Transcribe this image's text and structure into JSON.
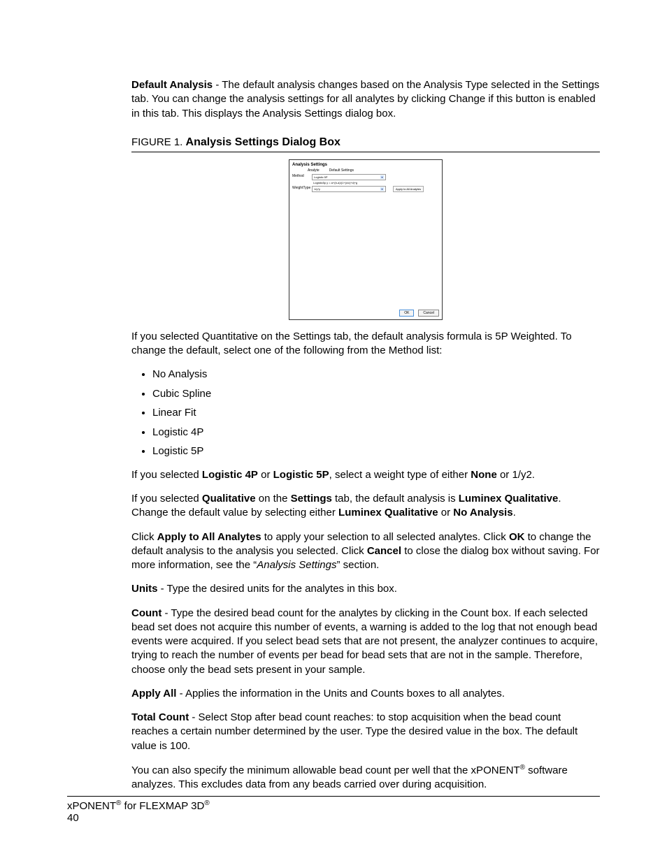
{
  "defaultAnalysis": {
    "label": "Default Analysis",
    "text": " - The default analysis changes based on the Analysis Type selected in the Settings tab. You can change the analysis settings for all analytes by clicking Change if this button is enabled in this tab. This displays the Analysis Settings dialog box."
  },
  "figure": {
    "label": "FIGURE 1. ",
    "title": "Analysis Settings Dialog Box"
  },
  "dialog": {
    "title": "Analysis Settings",
    "hdr1": "Analyte",
    "hdr2": "Default Settings",
    "methodLabel": "Method",
    "methodValue": "Logistic 5P",
    "formula": "Logistic5p y = a+(b-a)/(1+(x/c)^d)^g",
    "weightLabel": "WeightType",
    "weightValue": "1/y*y",
    "applyAll": "Apply to All Analytes",
    "ok": "OK",
    "cancel": "Cancel"
  },
  "postFigure": "If you selected Quantitative on the Settings tab, the default analysis formula is 5P Weighted. To change the default, select one of the following from the Method list:",
  "methods": [
    "No Analysis",
    "Cubic Spline",
    "Linear Fit",
    "Logistic 4P",
    "Logistic 5P"
  ],
  "logisticLine": {
    "p1": "If you selected ",
    "b1": "Logistic 4P",
    "p2": " or ",
    "b2": "Logistic 5P",
    "p3": ", select a weight type of either ",
    "b3": "None",
    "p4": " or 1/y2."
  },
  "qualLine": {
    "p1": "If you selected ",
    "b1": "Qualitative",
    "p2": " on the ",
    "b2": "Settings",
    "p3": " tab, the default analysis is ",
    "b3": "Luminex Qualitative",
    "p4": ". Change the default value by selecting either ",
    "b4": "Luminex Qualitative",
    "p5": " or ",
    "b5": "No Analysis",
    "p6": "."
  },
  "applyLine": {
    "p1": "Click ",
    "b1": "Apply to All Analytes",
    "p2": " to apply your selection to all selected analytes. Click ",
    "b2": "OK",
    "p3": " to change the default analysis to the analysis you selected. Click ",
    "b3": "Cancel",
    "p4": " to close the dialog box without saving. For more information, see the “",
    "i1": "Analysis Settings",
    "p5": "” section."
  },
  "units": {
    "label": "Units",
    "text": " - Type the desired units for the analytes in this box."
  },
  "count": {
    "label": "Count",
    "text": " - Type the desired bead count for the analytes by clicking in the Count box. If each selected bead set does not acquire this number of events, a warning is added to the log that not enough bead events were acquired. If you select bead sets that are not present, the analyzer continues to acquire, trying to reach the number of events per bead for bead sets that are not in the sample. Therefore, choose only the bead sets present in your sample."
  },
  "applyAllField": {
    "label": "Apply All",
    "text": " - Applies the information in the Units and Counts boxes to all analytes."
  },
  "totalCount": {
    "label": "Total Count",
    "text": " - Select Stop after bead count reaches: to stop acquisition when the bead count reaches a certain number determined by the user. Type the desired value in the box. The default value is 100."
  },
  "closing": {
    "p1": "You can also specify the minimum allowable bead count per well that the xPONENT",
    "sup1": "®",
    "p2": " software analyzes. This excludes data from any beads carried over during acquisition."
  },
  "footer": {
    "p1": "xPONENT",
    "sup1": "®",
    "p2": " for FLEXMAP 3D",
    "sup2": "®",
    "page": "40"
  }
}
